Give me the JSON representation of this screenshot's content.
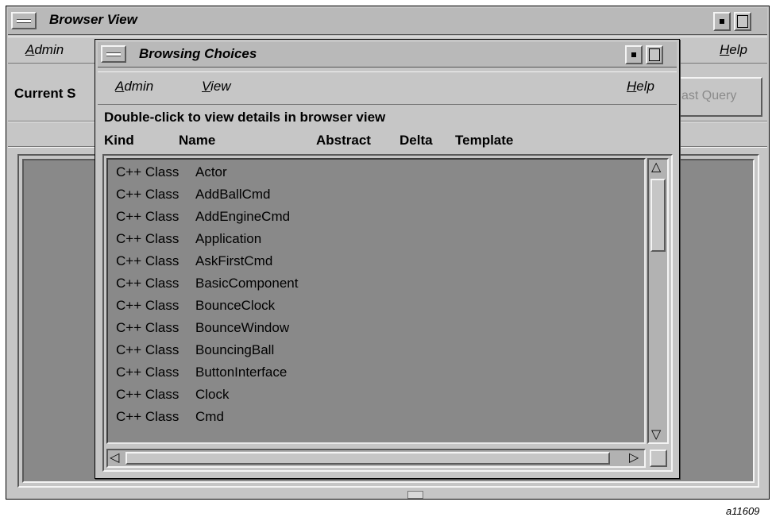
{
  "outer_window": {
    "title": "Browser View",
    "menu": {
      "admin": "dmin",
      "admin_mnemonic": "A",
      "help": "elp",
      "help_mnemonic": "H"
    },
    "current_label": "Current S",
    "last_query_label": "ast Query"
  },
  "dialog": {
    "title": "Browsing Choices",
    "menu": {
      "admin_mnemonic": "A",
      "admin": "dmin",
      "view_mnemonic": "V",
      "view": "iew",
      "help_mnemonic": "H",
      "help": "elp"
    },
    "instruction": "Double-click to view details in browser view",
    "columns": {
      "kind": "Kind",
      "name": "Name",
      "abstract": "Abstract",
      "delta": "Delta",
      "template": "Template"
    },
    "items": [
      {
        "kind": "C++ Class",
        "name": "Actor"
      },
      {
        "kind": "C++ Class",
        "name": "AddBallCmd"
      },
      {
        "kind": "C++ Class",
        "name": "AddEngineCmd"
      },
      {
        "kind": "C++ Class",
        "name": "Application"
      },
      {
        "kind": "C++ Class",
        "name": "AskFirstCmd"
      },
      {
        "kind": "C++ Class",
        "name": "BasicComponent"
      },
      {
        "kind": "C++ Class",
        "name": "BounceClock"
      },
      {
        "kind": "C++ Class",
        "name": "BounceWindow"
      },
      {
        "kind": "C++ Class",
        "name": "BouncingBall"
      },
      {
        "kind": "C++ Class",
        "name": "ButtonInterface"
      },
      {
        "kind": "C++ Class",
        "name": "Clock"
      },
      {
        "kind": "C++ Class",
        "name": "Cmd"
      }
    ]
  },
  "figure_label": "a11609",
  "icons": {
    "window_menu": "window-menu-icon",
    "minimize": "minimize-icon",
    "maximize": "maximize-icon",
    "scroll_up": "scroll-up-arrow-icon",
    "scroll_down": "scroll-down-arrow-icon",
    "scroll_left": "scroll-left-arrow-icon",
    "scroll_right": "scroll-right-arrow-icon"
  },
  "colors": {
    "window_bg": "#c6c6c6",
    "titlebar_bg": "#b9b9b9",
    "list_bg": "#898989",
    "disabled_text": "#8a8a8a"
  }
}
